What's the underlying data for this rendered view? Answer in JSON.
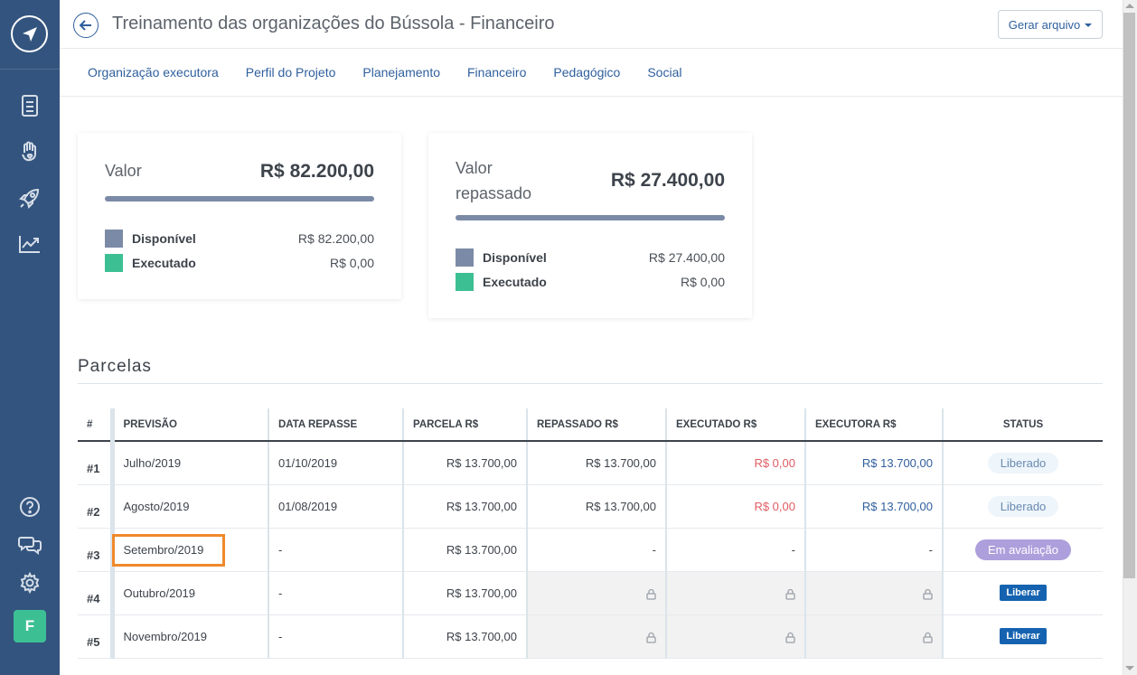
{
  "sidebar": {
    "logo_icon": "compass-icon",
    "nav_icons": [
      "document-icon",
      "hand-heart-icon",
      "rocket-icon",
      "chart-line-icon"
    ],
    "bottom_icons": [
      "help-icon",
      "chat-icon",
      "gear-icon"
    ],
    "avatar_letter": "F",
    "colors": {
      "background": "#33547e",
      "avatar": "#3dbf94"
    }
  },
  "header": {
    "title": "Treinamento das organizações do Bússola - Financeiro",
    "generate_button": "Gerar arquivo"
  },
  "tabs": [
    "Organização executora",
    "Perfil do Projeto",
    "Planejamento",
    "Financeiro",
    "Pedagógico",
    "Social"
  ],
  "cards": [
    {
      "label": "Valor",
      "value": "R$ 82.200,00",
      "disponivel_label": "Disponível",
      "disponivel_value": "R$ 82.200,00",
      "executado_label": "Executado",
      "executado_value": "R$ 0,00"
    },
    {
      "label": "Valor repassado",
      "value": "R$ 27.400,00",
      "disponivel_label": "Disponível",
      "disponivel_value": "R$ 27.400,00",
      "executado_label": "Executado",
      "executado_value": "R$ 0,00"
    }
  ],
  "parcelas": {
    "title": "Parcelas",
    "columns": [
      "#",
      "PREVISÃO",
      "DATA REPASSE",
      "PARCELA R$",
      "REPASSADO R$",
      "EXECUTADO R$",
      "EXECUTORA R$",
      "STATUS"
    ],
    "rows": [
      {
        "num": "#1",
        "previsao": "Julho/2019",
        "data_repasse": "01/10/2019",
        "parcela": "R$ 13.700,00",
        "repassado": "R$ 13.700,00",
        "executado": "R$ 0,00",
        "executora": "R$ 13.700,00",
        "status": "Liberado"
      },
      {
        "num": "#2",
        "previsao": "Agosto/2019",
        "data_repasse": "01/08/2019",
        "parcela": "R$ 13.700,00",
        "repassado": "R$ 13.700,00",
        "executado": "R$ 0,00",
        "executora": "R$ 13.700,00",
        "status": "Liberado"
      },
      {
        "num": "#3",
        "previsao": "Setembro/2019",
        "data_repasse": "-",
        "parcela": "R$ 13.700,00",
        "repassado": "-",
        "executado": "-",
        "executora": "-",
        "status": "Em avaliação"
      },
      {
        "num": "#4",
        "previsao": "Outubro/2019",
        "data_repasse": "-",
        "parcela": "R$ 13.700,00",
        "status": "Liberar"
      },
      {
        "num": "#5",
        "previsao": "Novembro/2019",
        "data_repasse": "-",
        "parcela": "R$ 13.700,00",
        "status": "Liberar"
      }
    ]
  },
  "colors": {
    "link": "#2f5f9e",
    "negative": "#e05c63",
    "disponivel": "#7b8aa6",
    "executado": "#3dbf94",
    "liberar_button": "#1563b0",
    "em_avaliacao": "#ad9fdc",
    "highlight_box": "#f0892b"
  }
}
